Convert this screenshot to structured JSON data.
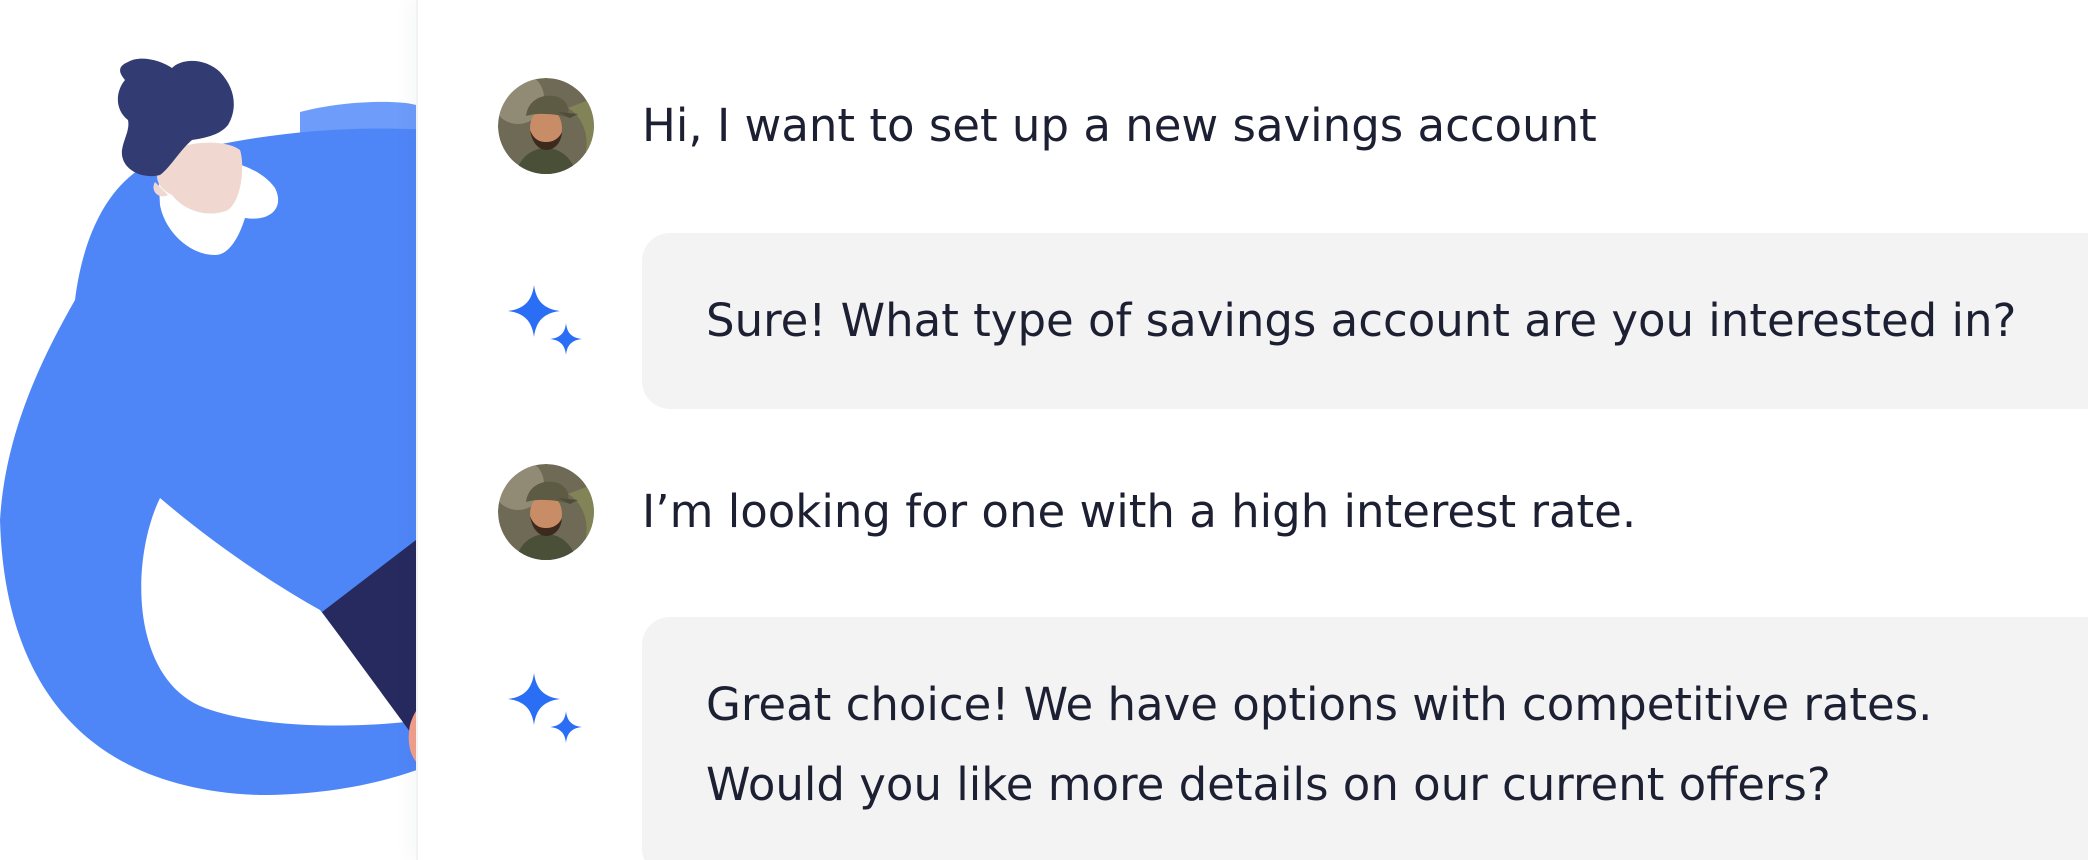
{
  "colors": {
    "accent_blue": "#2a6ef5",
    "person_blue": "#4f86f7",
    "hair_navy": "#333c72",
    "pants_navy": "#272a5f",
    "hand_peach": "#f3a08a",
    "bubble_bg": "#f3f3f3",
    "text": "#1d2033"
  },
  "icons": {
    "user_avatar": "user-avatar-photo",
    "assistant": "sparkle-icon"
  },
  "conversation": [
    {
      "role": "user",
      "text": "Hi, I want to set up a new savings account"
    },
    {
      "role": "assistant",
      "lines": [
        "Sure! What type of savings account are you interested in?"
      ]
    },
    {
      "role": "user",
      "text": "I’m looking for one with a high interest rate."
    },
    {
      "role": "assistant",
      "lines": [
        "Great choice! We have options with competitive rates.",
        "Would you like more details on our current offers?"
      ]
    }
  ]
}
